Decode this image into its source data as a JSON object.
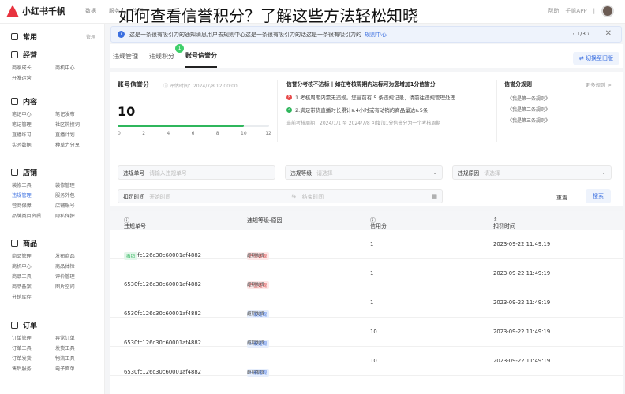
{
  "overlay_title": "如何查看信誉积分？了解这些方法轻松知晓",
  "app": {
    "name": "小红书千帆"
  },
  "topnav": [
    "数据",
    "服务",
    "学习"
  ],
  "topright": {
    "help": "帮助",
    "app": "千帆APP",
    "more": "|"
  },
  "notice": {
    "text": "这是一条很有吸引力的通知消息用户去规则中心这是一条很有吸引力的话这是一条很有吸引力的",
    "link": "规则中心",
    "pager": "1/3"
  },
  "sidebar": {
    "sections": [
      {
        "title": "常用",
        "right": "管理",
        "items": []
      },
      {
        "title": "经营",
        "items": [
          "商家成长",
          "商机中心",
          "开发运营"
        ]
      },
      {
        "title": "内容",
        "items": [
          "笔记中心",
          "笔记发布",
          "笔记管理",
          "社区热搜词",
          "直播练习",
          "直播计划",
          "实时数据",
          "种草力分享"
        ]
      },
      {
        "title": "店铺",
        "items": [
          "装修工具",
          "装修管理",
          "违规管理",
          "服务外包",
          "营商保障",
          "店铺账号",
          "品牌类目资质",
          "隐私保护"
        ]
      },
      {
        "title": "商品",
        "items": [
          "商品管理",
          "发布商品",
          "商机中心",
          "商品体检",
          "商品工具",
          "评价管理",
          "商品备案",
          "图片空间",
          "分销库存"
        ]
      },
      {
        "title": "订单",
        "items": [
          "订单管理",
          "异常订单",
          "订单工具",
          "发货工具",
          "订单发货",
          "物流工具",
          "售后服务",
          "电子面单"
        ]
      }
    ],
    "active": "违规管理"
  },
  "tabs": [
    {
      "label": "违规管理"
    },
    {
      "label": "违规积分",
      "badge": "1"
    },
    {
      "label": "账号信誉分",
      "active": true
    }
  ],
  "switch_label": "切换至旧版",
  "score": {
    "title": "账号信誉分",
    "subtitle": "评估时间：2024/7/8 12:00:00",
    "value": 10,
    "max": 12,
    "ticks": [
      "0",
      "2",
      "4",
      "6",
      "8",
      "10",
      "12"
    ]
  },
  "warning": {
    "title": "信誉分考核不达标 | 如在考核周期内达标可为您增加1分信誉分",
    "items": [
      {
        "status": "fail",
        "text": "1.考核周期内需无违规。您当前有 5 条违规记录，请前往违规管理处理"
      },
      {
        "status": "pass",
        "text": "2.满足带货直播时长累计≥4小时或有动销的商品量达≥5条"
      }
    ],
    "footer": "当前考核周期：2024/1/1 至 2024/7/8  可增加1分信誉分为一个考核周期"
  },
  "rules": {
    "title": "信誉分规则",
    "more": "更多规则 >",
    "items": [
      "《我是第一条规则》",
      "《我是第二条规则》",
      "《我是第三条规则》"
    ]
  },
  "filters": {
    "violation_no": {
      "label": "违规单号",
      "placeholder": "请输入违规单号"
    },
    "level": {
      "label": "违规等级",
      "placeholder": "请选择"
    },
    "reason": {
      "label": "违规原因",
      "placeholder": "请选择"
    },
    "time": {
      "label": "扣罚时间",
      "start": "开始时间",
      "end": "结束时间"
    },
    "reset": "重置",
    "search": "搜索"
  },
  "table": {
    "columns": [
      "违规单号",
      "违规等级-原因",
      "信用分",
      "扣罚时间"
    ],
    "rows": [
      {
        "no": "6530fc126c30c60001af4882",
        "tag": "撤销",
        "level": "严重违规",
        "level_type": "red",
        "reason": "超期发货",
        "score": "1",
        "time": "2023-09-22 11:49:19"
      },
      {
        "no": "6530fc126c30c60001af4882",
        "tag": "",
        "level": "严重违规",
        "level_type": "red",
        "reason": "超期发货",
        "score": "1",
        "time": "2023-09-22 11:49:19"
      },
      {
        "no": "6530fc126c30c60001af4882",
        "tag": "",
        "level": "一般违规",
        "level_type": "blue",
        "reason": "超期发货",
        "score": "1",
        "time": "2023-09-22 11:49:19"
      },
      {
        "no": "6530fc126c30c60001af4882",
        "tag": "",
        "level": "一般违规",
        "level_type": "blue",
        "reason": "超期发货",
        "score": "10",
        "time": "2023-09-22 11:49:19"
      },
      {
        "no": "6530fc126c30c60001af4882",
        "tag": "",
        "level": "一般违规",
        "level_type": "blue",
        "reason": "超期发货",
        "score": "10",
        "time": "2023-09-22 11:49:19"
      }
    ]
  }
}
